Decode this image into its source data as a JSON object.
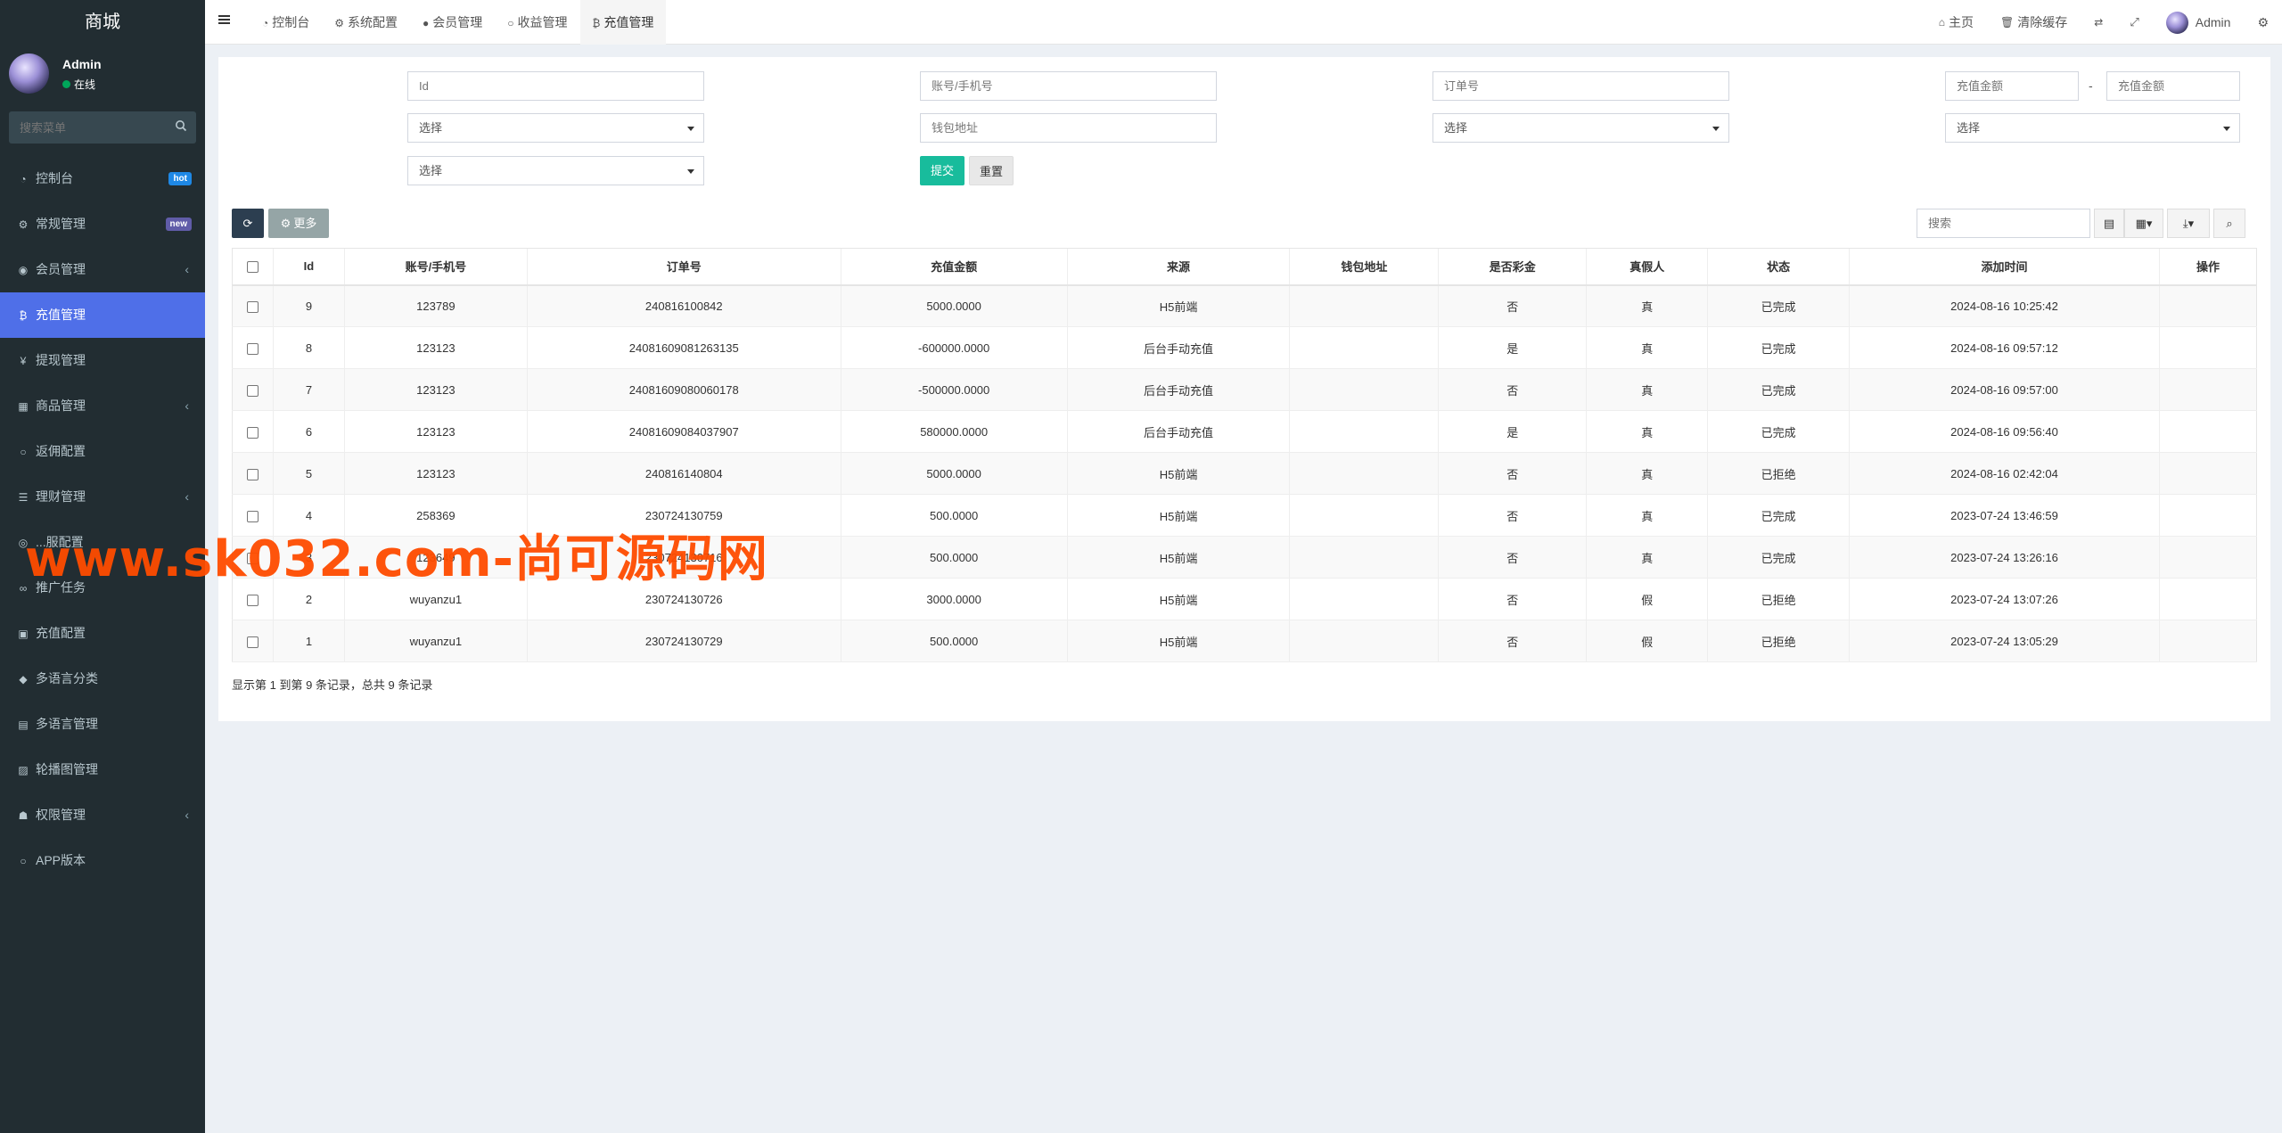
{
  "sidebar": {
    "logo": "商城",
    "user_name": "Admin",
    "user_status": "在线",
    "search_placeholder": "搜索菜单",
    "items": [
      {
        "label": "控制台",
        "icon": "dashboard-icon",
        "glyph": "◔",
        "badge": "hot"
      },
      {
        "label": "常规管理",
        "icon": "cogs-icon",
        "glyph": "⚙",
        "badge": "new"
      },
      {
        "label": "会员管理",
        "icon": "user-circle-icon",
        "glyph": "◉",
        "caret": true
      },
      {
        "label": "充值管理",
        "icon": "bitcoin-icon",
        "glyph": "₿",
        "active": true
      },
      {
        "label": "提现管理",
        "icon": "yen-icon",
        "glyph": "¥"
      },
      {
        "label": "商品管理",
        "icon": "shopping-cart-icon",
        "glyph": "▦",
        "caret": true
      },
      {
        "label": "返佣配置",
        "icon": "circle-icon",
        "glyph": "○"
      },
      {
        "label": "理财管理",
        "icon": "list-icon",
        "glyph": "☰",
        "caret": true
      },
      {
        "label": "...服配置",
        "icon": "gear-icon",
        "glyph": "◎"
      },
      {
        "label": "推广任务",
        "icon": "link-icon",
        "glyph": "∞"
      },
      {
        "label": "充值配置",
        "icon": "money-icon",
        "glyph": "▣"
      },
      {
        "label": "多语言分类",
        "icon": "tag-icon",
        "glyph": "◆"
      },
      {
        "label": "多语言管理",
        "icon": "book-icon",
        "glyph": "▤"
      },
      {
        "label": "轮播图管理",
        "icon": "image-icon",
        "glyph": "▨"
      },
      {
        "label": "权限管理",
        "icon": "group-icon",
        "glyph": "☗",
        "caret": true
      },
      {
        "label": "APP版本",
        "icon": "circle-icon",
        "glyph": "○"
      }
    ]
  },
  "header": {
    "tabs": [
      {
        "label": "控制台",
        "icon": "dashboard-icon",
        "glyph": "◔"
      },
      {
        "label": "系统配置",
        "icon": "gear-icon",
        "glyph": "⚙"
      },
      {
        "label": "会员管理",
        "icon": "user-icon",
        "glyph": "●"
      },
      {
        "label": "收益管理",
        "icon": "circle-icon",
        "glyph": "○"
      },
      {
        "label": "充值管理",
        "icon": "bitcoin-icon",
        "glyph": "₿",
        "active": true
      }
    ],
    "home_label": "主页",
    "clear_cache_label": "清除缓存",
    "user_name": "Admin"
  },
  "filters": {
    "id_label": "Id",
    "id_placeholder": "Id",
    "account_label": "账号/手机号",
    "account_placeholder": "账号/手机号",
    "order_label": "订单号",
    "order_placeholder": "订单号",
    "amount_label": "充值金额",
    "amount_min_placeholder": "充值金额",
    "amount_sep": "-",
    "amount_max_placeholder": "充值金额",
    "source_label": "来源",
    "source_value": "选择",
    "wallet_label": "钱包地址",
    "wallet_placeholder": "钱包地址",
    "bonus_label": "是否彩金",
    "bonus_value": "选择",
    "real_label": "真假人",
    "real_value": "选择",
    "status_label": "状态",
    "status_value": "选择",
    "submit_label": "提交",
    "reset_label": "重置"
  },
  "toolbar": {
    "more_label": "更多",
    "search_placeholder": "搜索"
  },
  "table": {
    "columns": [
      "Id",
      "账号/手机号",
      "订单号",
      "充值金额",
      "来源",
      "钱包地址",
      "是否彩金",
      "真假人",
      "状态",
      "添加时间",
      "操作"
    ],
    "rows": [
      [
        "9",
        "123789",
        "240816100842",
        "5000.0000",
        "H5前端",
        "",
        "否",
        "真",
        "已完成",
        "2024-08-16 10:25:42",
        ""
      ],
      [
        "8",
        "123123",
        "24081609081263135",
        "-600000.0000",
        "后台手动充值",
        "",
        "是",
        "真",
        "已完成",
        "2024-08-16 09:57:12",
        ""
      ],
      [
        "7",
        "123123",
        "24081609080060178",
        "-500000.0000",
        "后台手动充值",
        "",
        "否",
        "真",
        "已完成",
        "2024-08-16 09:57:00",
        ""
      ],
      [
        "6",
        "123123",
        "24081609084037907",
        "580000.0000",
        "后台手动充值",
        "",
        "是",
        "真",
        "已完成",
        "2024-08-16 09:56:40",
        ""
      ],
      [
        "5",
        "123123",
        "240816140804",
        "5000.0000",
        "H5前端",
        "",
        "否",
        "真",
        "已拒绝",
        "2024-08-16 02:42:04",
        ""
      ],
      [
        "4",
        "258369",
        "230724130759",
        "500.0000",
        "H5前端",
        "",
        "否",
        "真",
        "已完成",
        "2023-07-24 13:46:59",
        ""
      ],
      [
        "3",
        "123649",
        "230724130716",
        "500.0000",
        "H5前端",
        "",
        "否",
        "真",
        "已完成",
        "2023-07-24 13:26:16",
        ""
      ],
      [
        "2",
        "wuyanzu1",
        "230724130726",
        "3000.0000",
        "H5前端",
        "",
        "否",
        "假",
        "已拒绝",
        "2023-07-24 13:07:26",
        ""
      ],
      [
        "1",
        "wuyanzu1",
        "230724130729",
        "500.0000",
        "H5前端",
        "",
        "否",
        "假",
        "已拒绝",
        "2023-07-24 13:05:29",
        ""
      ]
    ]
  },
  "pagination_info": "显示第 1 到第 9 条记录，总共 9 条记录",
  "watermark": "www.sk032.com-尚可源码网",
  "colors": {
    "sidebar_bg": "#222d32",
    "active_menu": "#4f6fe8",
    "submit": "#18bc9c",
    "refresh": "#2c3e50",
    "watermark": "#ff4c00"
  }
}
